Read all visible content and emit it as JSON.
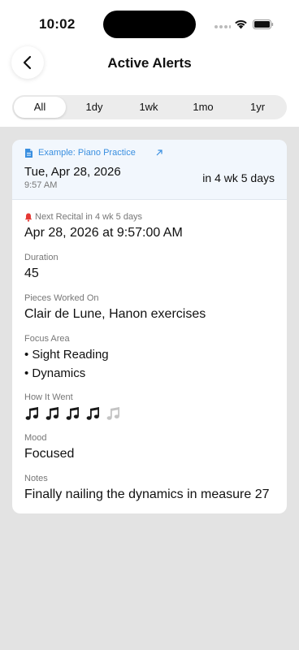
{
  "status": {
    "time": "10:02"
  },
  "nav": {
    "title": "Active Alerts",
    "back": "chevron-left-icon"
  },
  "segments": [
    "All",
    "1dy",
    "1wk",
    "1mo",
    "1yr"
  ],
  "card": {
    "source": "Example: Piano Practice",
    "date": "Tue, Apr 28, 2026",
    "time": "9:57 AM",
    "relative": "in 4 wk 5 days",
    "recital_label": "Next Recital",
    "recital_in": "in 4 wk 5 days",
    "recital_value": "Apr 28, 2026 at 9:57:00 AM",
    "duration_label": "Duration",
    "duration_value": "45",
    "pieces_label": "Pieces Worked On",
    "pieces_value": "Clair de Lune, Hanon exercises",
    "focus_label": "Focus Area",
    "focus_items": [
      "• Sight Reading",
      "• Dynamics"
    ],
    "how_label": "How It Went",
    "how_rating": 4,
    "how_max": 5,
    "mood_label": "Mood",
    "mood_value": "Focused",
    "notes_label": "Notes",
    "notes_value": "Finally nailing the dynamics in measure 27"
  },
  "colors": {
    "accent": "#3a8fe0",
    "alert": "#e53935",
    "background": "#e3e3e3"
  }
}
